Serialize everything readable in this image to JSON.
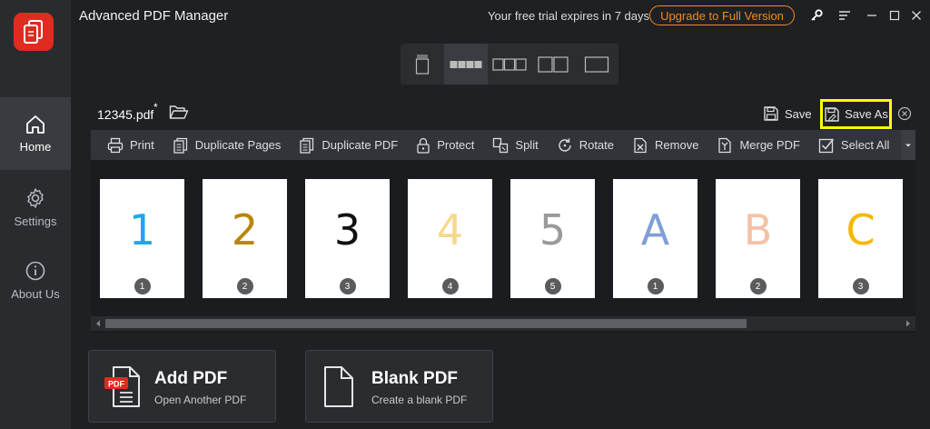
{
  "app": {
    "title": "Advanced PDF Manager",
    "trial_text": "Your free trial expires in 7 days",
    "upgrade_label": "Upgrade to Full Version",
    "accent_color": "#f08a24",
    "brand_color": "#e02b20"
  },
  "sidebar": {
    "items": [
      {
        "label": "Home",
        "icon": "home-icon",
        "active": true
      },
      {
        "label": "Settings",
        "icon": "gear-icon",
        "active": false
      },
      {
        "label": "About Us",
        "icon": "info-icon",
        "active": false
      }
    ]
  },
  "document": {
    "filename": "12345.pdf",
    "modified_marker": "*",
    "save_label": "Save",
    "save_as_label": "Save As"
  },
  "toolbar": {
    "items": [
      {
        "label": "Print",
        "icon": "printer-icon"
      },
      {
        "label": "Duplicate Pages",
        "icon": "duplicate-pages-icon"
      },
      {
        "label": "Duplicate PDF",
        "icon": "duplicate-pdf-icon"
      },
      {
        "label": "Protect",
        "icon": "lock-icon"
      },
      {
        "label": "Split",
        "icon": "split-icon"
      },
      {
        "label": "Rotate",
        "icon": "rotate-icon"
      },
      {
        "label": "Remove",
        "icon": "remove-icon"
      },
      {
        "label": "Merge PDF",
        "icon": "merge-icon"
      },
      {
        "label": "Select All",
        "icon": "checkbox-icon"
      }
    ]
  },
  "pages": [
    {
      "content": "1",
      "badge": "1",
      "color": "#1ea8e8"
    },
    {
      "content": "2",
      "badge": "2",
      "color": "#b8860b"
    },
    {
      "content": "3",
      "badge": "3",
      "color": "#111111"
    },
    {
      "content": "4",
      "badge": "4",
      "color": "#f5d98a"
    },
    {
      "content": "5",
      "badge": "5",
      "color": "#9a9a9a"
    },
    {
      "content": "A",
      "badge": "1",
      "color": "#7f9fd6"
    },
    {
      "content": "B",
      "badge": "2",
      "color": "#f3c2a6"
    },
    {
      "content": "C",
      "badge": "3",
      "color": "#f5b800"
    }
  ],
  "cards": {
    "add_pdf": {
      "title": "Add PDF",
      "subtitle": "Open Another PDF",
      "badge": "PDF"
    },
    "blank_pdf": {
      "title": "Blank PDF",
      "subtitle": "Create a blank PDF"
    }
  }
}
